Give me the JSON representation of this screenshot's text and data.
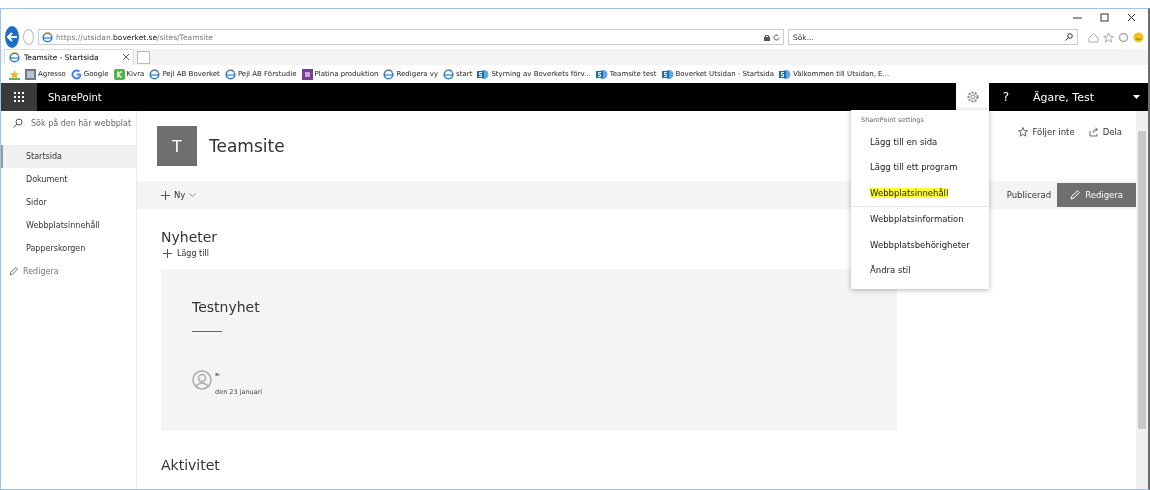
{
  "browser": {
    "url": "https://utsidan.**boverket.se**/sites/Teamsite",
    "search_placeholder": "Sök...",
    "tabs": [
      {
        "title": "Teamsite - Startsida",
        "selected": true
      }
    ],
    "favorites": [
      {
        "label": "Agresso",
        "kind": "app"
      },
      {
        "label": "Google",
        "kind": "google"
      },
      {
        "label": "Kivra",
        "kind": "kivra"
      },
      {
        "label": "Pejl AB  Boverket",
        "kind": "ie"
      },
      {
        "label": "Pejl AB  Förstudie",
        "kind": "ie"
      },
      {
        "label": "Platina produktion",
        "kind": "platina"
      },
      {
        "label": "Redigera vy",
        "kind": "ie"
      },
      {
        "label": "start",
        "kind": "ie"
      },
      {
        "label": "Styrning av Boverkets förv...",
        "kind": "sp"
      },
      {
        "label": "Teamsite test",
        "kind": "sp"
      },
      {
        "label": "Boverket Utsidan - Startsida",
        "kind": "sp"
      },
      {
        "label": "Välkommen till Utsidan, E...",
        "kind": "sp"
      }
    ]
  },
  "suite_bar": {
    "app_name": "SharePoint",
    "help": "?",
    "user_name": "Ägare, Test"
  },
  "nav": {
    "search_placeholder": "Sök på den här webbplat",
    "items": [
      {
        "label": "Startsida",
        "selected": true
      },
      {
        "label": "Dokument",
        "selected": false
      },
      {
        "label": "Sidor",
        "selected": false
      },
      {
        "label": "Webbplatsinnehåll",
        "selected": false
      },
      {
        "label": "Papperskorgen",
        "selected": false
      }
    ],
    "edit_link": "Redigera"
  },
  "site": {
    "logo_letter": "T",
    "title": "Teamsite",
    "follow": "Följer inte",
    "share": "Dela"
  },
  "command_bar": {
    "new": "Ny",
    "status": "Publicerad",
    "edit": "Redigera"
  },
  "news": {
    "heading": "Nyheter",
    "add": "Lägg till",
    "card": {
      "title": "Testnyhet",
      "date": "den 23 januari"
    }
  },
  "activity": {
    "heading": "Aktivitet"
  },
  "settings_menu": {
    "header": "SharePoint settings",
    "items": [
      {
        "label": "Lägg till en sida",
        "highlighted": false
      },
      {
        "label": "Lägg till ett program",
        "highlighted": false
      },
      {
        "label": "Webbplatsinnehåll",
        "highlighted": true
      },
      {
        "label": "Webbplatsinformation",
        "highlighted": false
      },
      {
        "label": "Webbplatsbehörigheter",
        "highlighted": false
      },
      {
        "label": "Ändra stil",
        "highlighted": false
      }
    ]
  }
}
